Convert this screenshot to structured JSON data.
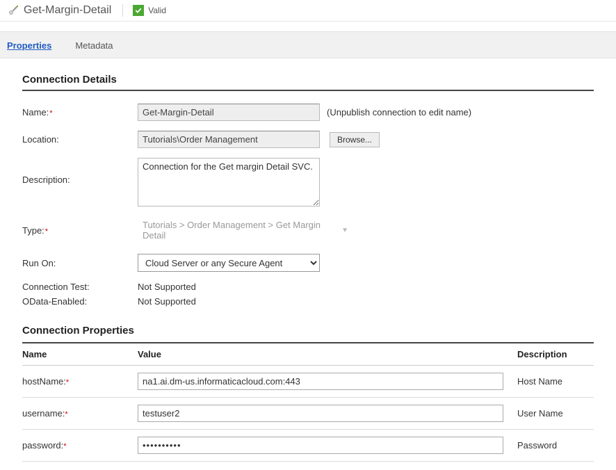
{
  "header": {
    "title": "Get-Margin-Detail",
    "status_text": "Valid"
  },
  "tabs": {
    "properties": "Properties",
    "metadata": "Metadata"
  },
  "labels": {
    "section_connection_details": "Connection Details",
    "name": "Name:",
    "location": "Location:",
    "description": "Description:",
    "type": "Type:",
    "run_on": "Run On:",
    "connection_test": "Connection Test:",
    "odata_enabled": "OData-Enabled:",
    "section_connection_properties": "Connection Properties",
    "col_name": "Name",
    "col_value": "Value",
    "col_description": "Description",
    "unpublish_note": "(Unpublish connection to edit name)",
    "browse": "Browse..."
  },
  "fields": {
    "name_value": "Get-Margin-Detail",
    "location_value": "Tutorials\\Order Management",
    "description_value": "Connection for the Get margin Detail SVC.",
    "type_display": "Tutorials > Order Management > Get Margin Detail",
    "run_on_value": "Cloud Server or any Secure Agent",
    "connection_test_value": "Not Supported",
    "odata_enabled_value": "Not Supported"
  },
  "properties": [
    {
      "name": "hostName:",
      "required": true,
      "value": "na1.ai.dm-us.informaticacloud.com:443",
      "description": "Host Name",
      "type": "text",
      "data_name": "host-name"
    },
    {
      "name": "username:",
      "required": true,
      "value": "testuser2",
      "description": "User Name",
      "type": "text",
      "data_name": "username"
    },
    {
      "name": "password:",
      "required": true,
      "value": "••••••••••",
      "description": "Password",
      "type": "password",
      "data_name": "password"
    }
  ]
}
